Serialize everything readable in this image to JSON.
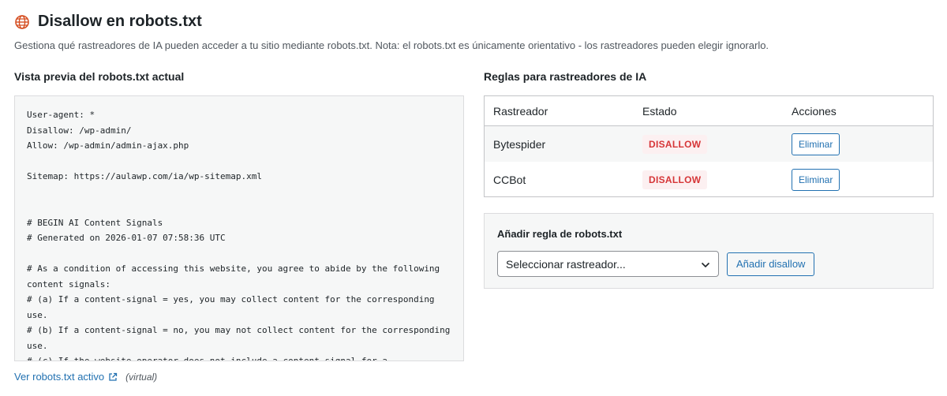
{
  "header": {
    "title": "Disallow en robots.txt",
    "description": "Gestiona qué rastreadores de IA pueden acceder a tu sitio mediante robots.txt. Nota: el robots.txt es únicamente orientativo - los rastreadores pueden elegir ignorarlo."
  },
  "preview": {
    "heading": "Vista previa del robots.txt actual",
    "content": "User-agent: *\nDisallow: /wp-admin/\nAllow: /wp-admin/admin-ajax.php\n\nSitemap: https://aulawp.com/ia/wp-sitemap.xml\n\n\n# BEGIN AI Content Signals\n# Generated on 2026-01-07 07:58:36 UTC\n\n# As a condition of accessing this website, you agree to abide by the following content signals:\n# (a) If a content-signal = yes, you may collect content for the corresponding use.\n# (b) If a content-signal = no, you may not collect content for the corresponding use.\n# (c) If the website operator does not include a content signal for a",
    "link_label": "Ver robots.txt activo",
    "virtual_note": "(virtual)"
  },
  "rules": {
    "heading": "Reglas para rastreadores de IA",
    "columns": [
      "Rastreador",
      "Estado",
      "Acciones"
    ],
    "rows": [
      {
        "crawler": "Bytespider",
        "status": "DISALLOW",
        "action": "Eliminar"
      },
      {
        "crawler": "CCBot",
        "status": "DISALLOW",
        "action": "Eliminar"
      }
    ]
  },
  "add_rule": {
    "title": "Añadir regla de robots.txt",
    "select_value": "Seleccionar rastreador...",
    "button_label": "Añadir disallow"
  },
  "colors": {
    "accent": "#2271b1",
    "danger": "#d63638",
    "globe": "#d54e21"
  },
  "icons": [
    "globe-icon",
    "external-link-icon",
    "chevron-down-icon"
  ]
}
